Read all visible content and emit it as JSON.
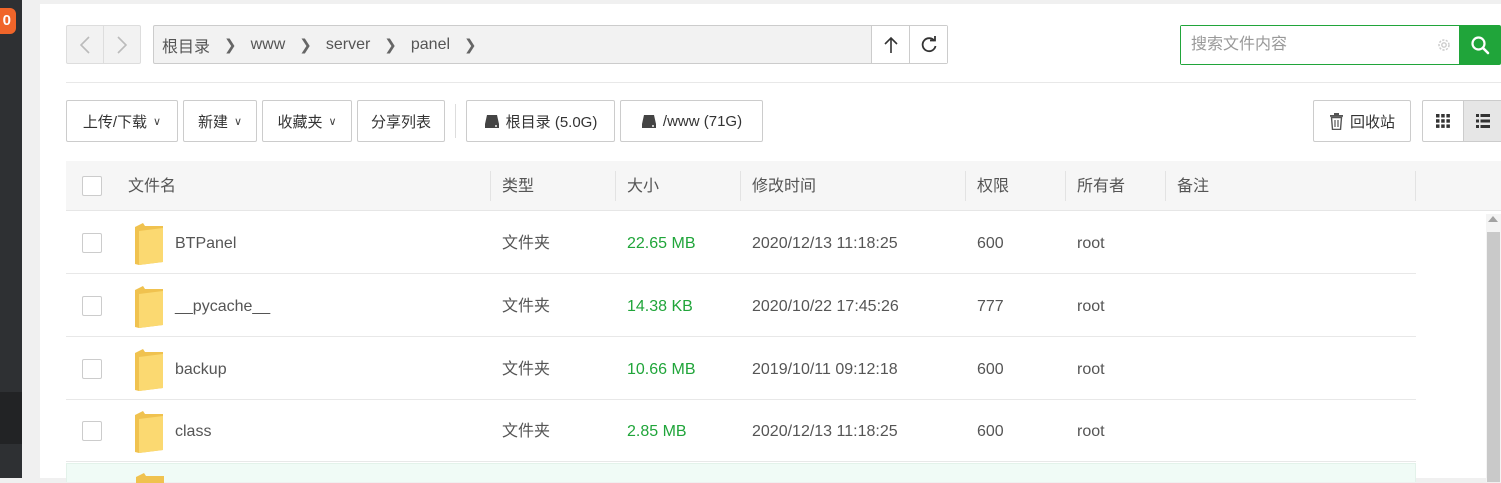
{
  "sidebar": {
    "badge": "0"
  },
  "nav": {
    "crumbs": [
      "根目录",
      "www",
      "server",
      "panel"
    ]
  },
  "search": {
    "placeholder": "搜索文件内容"
  },
  "toolbar": {
    "upload_download": "上传/下载",
    "new": "新建",
    "favorites": "收藏夹",
    "share_list": "分享列表",
    "disk_root": "根目录 (5.0G)",
    "disk_www": "/www (71G)",
    "recycle_bin": "回收站"
  },
  "table": {
    "headers": {
      "name": "文件名",
      "type": "类型",
      "size": "大小",
      "modified": "修改时间",
      "permission": "权限",
      "owner": "所有者",
      "note": "备注"
    },
    "rows": [
      {
        "name": "BTPanel",
        "type": "文件夹",
        "size": "22.65 MB",
        "modified": "2020/12/13 11:18:25",
        "permission": "600",
        "owner": "root"
      },
      {
        "name": "__pycache__",
        "type": "文件夹",
        "size": "14.38 KB",
        "modified": "2020/10/22 17:45:26",
        "permission": "777",
        "owner": "root"
      },
      {
        "name": "backup",
        "type": "文件夹",
        "size": "10.66 MB",
        "modified": "2019/10/11 09:12:18",
        "permission": "600",
        "owner": "root"
      },
      {
        "name": "class",
        "type": "文件夹",
        "size": "2.85 MB",
        "modified": "2020/12/13 11:18:25",
        "permission": "600",
        "owner": "root"
      }
    ]
  },
  "colors": {
    "accent": "#20a53a",
    "folder": "#f9d46c"
  }
}
